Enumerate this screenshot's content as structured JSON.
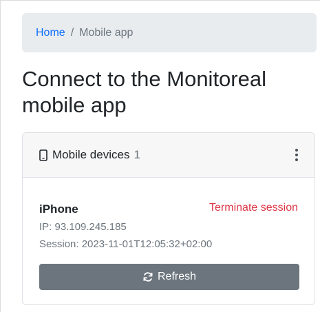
{
  "breadcrumb": {
    "home_label": "Home",
    "separator": "/",
    "current_label": "Mobile app"
  },
  "page": {
    "title": "Connect to the Monitoreal mobile app"
  },
  "devices_card": {
    "header_label": "Mobile devices",
    "count": "1",
    "header_icon": "mobile-phone-icon",
    "menu_icon": "kebab-menu-icon",
    "device": {
      "name": "iPhone",
      "terminate_label": "Terminate session",
      "ip_text": "IP: 93.109.245.185",
      "session_text": "Session: 2023-11-01T12:05:32+02:00"
    },
    "refresh_label": "Refresh",
    "refresh_icon": "refresh-icon"
  },
  "colors": {
    "link": "#0d6efd",
    "danger": "#dc3545",
    "secondary": "#6c757d",
    "breadcrumb_bg": "#e9ecef",
    "card_header_bg": "#f7f7f7"
  }
}
